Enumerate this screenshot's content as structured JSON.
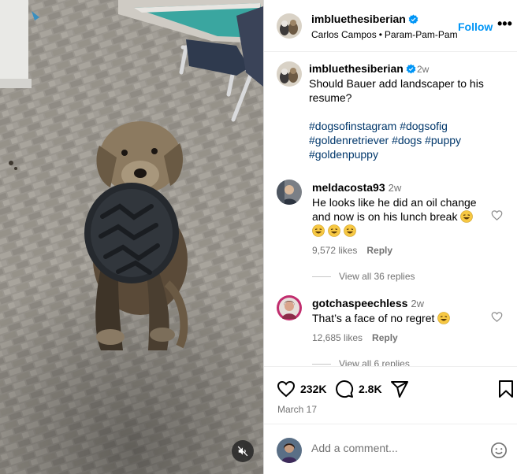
{
  "post": {
    "media": {
      "description_icon": "muted-speaker-icon"
    },
    "author": {
      "username": "imbluethesiberian",
      "verified": true,
      "subtitle_name": "Carlos Campos",
      "subtitle_audio": "Param-Pam-Pam",
      "follow_label": "Follow",
      "more_label": "•••"
    },
    "caption": {
      "username": "imbluethesiberian",
      "time": "2w",
      "text": "Should Bauer add landscaper to his resume?",
      "hashtags": [
        "#dogsofinstagram",
        "#dogsofig",
        "#goldenretriever",
        "#dogs",
        "#puppy",
        "#goldenpuppy"
      ]
    },
    "comments": [
      {
        "username": "meldacosta93",
        "time": "2w",
        "text": "He looks like he did an oil change and now is on his lunch break",
        "likes": "9,572 likes",
        "reply_label": "Reply",
        "view_replies": "View all 36 replies"
      },
      {
        "username": "gotchaspeechless",
        "time": "2w",
        "text": "That’s a face of no regret",
        "likes": "12,685 likes",
        "reply_label": "Reply",
        "view_replies": "View all 6 replies"
      }
    ],
    "actions": {
      "likes_count": "232K",
      "comments_count": "2.8K",
      "date": "March 17"
    },
    "add_comment": {
      "placeholder": "Add a comment..."
    }
  },
  "colors": {
    "accent": "#0095f6",
    "hashtag": "#00376b",
    "verified": "#0095f6",
    "muted_text": "#737373"
  }
}
